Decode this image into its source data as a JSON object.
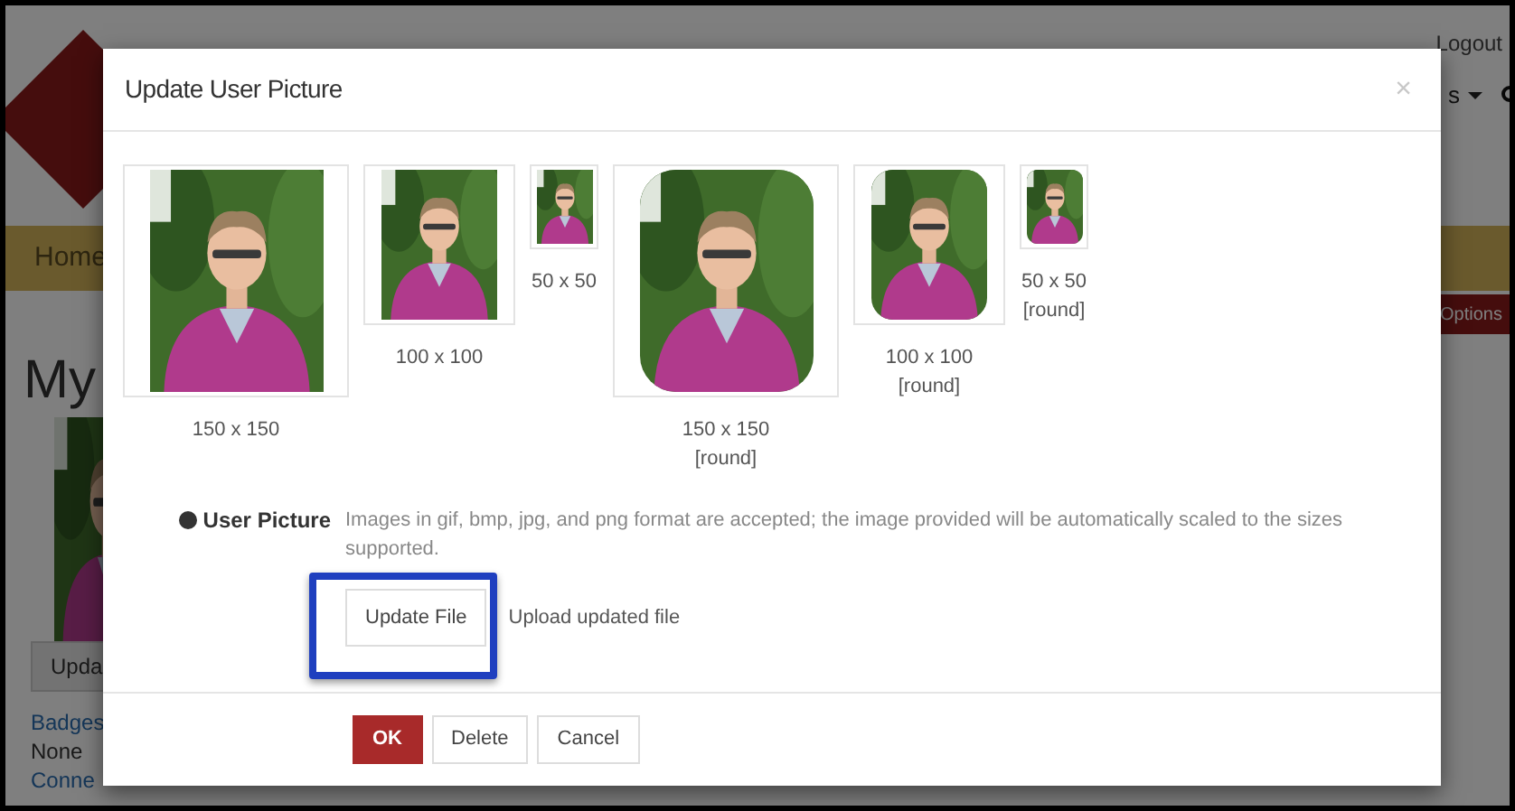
{
  "background_page": {
    "user_menu": [
      "Logout"
    ],
    "nav_item": "Home",
    "menu_fragment": "s",
    "options_button": "Options",
    "heading": "My",
    "update_button": "Upda",
    "links": [
      {
        "text": "Badges",
        "kind": "link"
      },
      {
        "text": "None",
        "kind": "plain"
      },
      {
        "text": "Conne",
        "kind": "link"
      }
    ]
  },
  "dialog": {
    "title": "Update User Picture",
    "close": "×",
    "thumbnails": [
      {
        "kind": "large",
        "round": false,
        "caption": "150 x 150"
      },
      {
        "kind": "medium",
        "round": false,
        "caption": "100 x 100"
      },
      {
        "kind": "small",
        "round": false,
        "caption": "50 x 50"
      },
      {
        "kind": "large",
        "round": true,
        "caption": "150 x 150",
        "note": "[round]"
      },
      {
        "kind": "medium",
        "round": true,
        "caption": "100 x 100",
        "note": "[round]"
      },
      {
        "kind": "small",
        "round": true,
        "caption": "50 x 50",
        "note": "[round]"
      }
    ],
    "field": {
      "label": "User Picture",
      "help": "Images in gif, bmp, jpg, and png format are accepted; the image provided will be automatically scaled to the sizes supported.",
      "button": "Update File",
      "note": "Upload updated file",
      "highlighted": true
    },
    "buttons": [
      {
        "label": "OK",
        "kind": "primary"
      },
      {
        "label": "Delete",
        "kind": "default"
      },
      {
        "label": "Cancel",
        "kind": "default"
      }
    ]
  }
}
